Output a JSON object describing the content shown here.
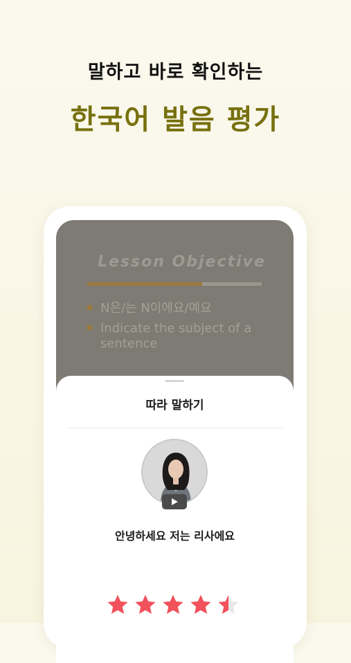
{
  "headline": {
    "subtitle": "말하고 바로 확인하는",
    "title": "한국어 발음 평가"
  },
  "lesson": {
    "title": "Lesson Objective",
    "progress_fraction": 0.66,
    "bullets": [
      "N은/는 N이에요/예요",
      "Indicate the subject of a sentence"
    ]
  },
  "sheet": {
    "title": "따라 말하기",
    "sentence": "안녕하세요 저는 리사에요",
    "video_icon": "play-icon",
    "rating": 4.5,
    "rating_max": 5
  },
  "colors": {
    "background": "#f8f4df",
    "accent": "#77710f",
    "star": "#f1525c",
    "star_empty": "#e8e8e8",
    "lesson_bg": "#7d7b73",
    "lesson_accent": "#9e7a3e"
  }
}
